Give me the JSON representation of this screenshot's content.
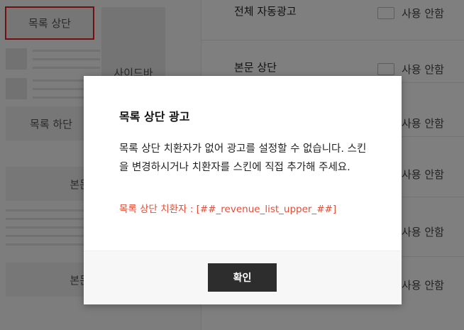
{
  "left_panel": {
    "selected_slot_label": "목록 상단",
    "sidebar_label": "사이드바",
    "list_bottom_label": "목록 하단",
    "body_label_1": "본문",
    "body_label_2": "본문"
  },
  "settings": {
    "rows": [
      {
        "title": "전체 자동광고",
        "status": "사용 안함"
      },
      {
        "title": "본문 상단",
        "status": "사용 안함"
      },
      {
        "title": "",
        "status": "사용 안함"
      },
      {
        "title": "",
        "status": "사용 안함"
      },
      {
        "title": "",
        "status": "사용 안함"
      },
      {
        "title": "",
        "status": "사용 안함"
      }
    ]
  },
  "modal": {
    "title": "목록 상단 광고",
    "message": "목록 상단 치환자가 없어 광고를 설정할 수 없습니다. 스킨을 변경하시거나 치환자를 스킨에 직접 추가해 주세요.",
    "code_text": "목록 상단 치환자 : [##_revenue_list_upper_##]",
    "confirm_label": "확인"
  },
  "colors": {
    "highlight_border": "#e02020",
    "code_text": "#e0503a",
    "button_bg": "#2d2d2d"
  }
}
